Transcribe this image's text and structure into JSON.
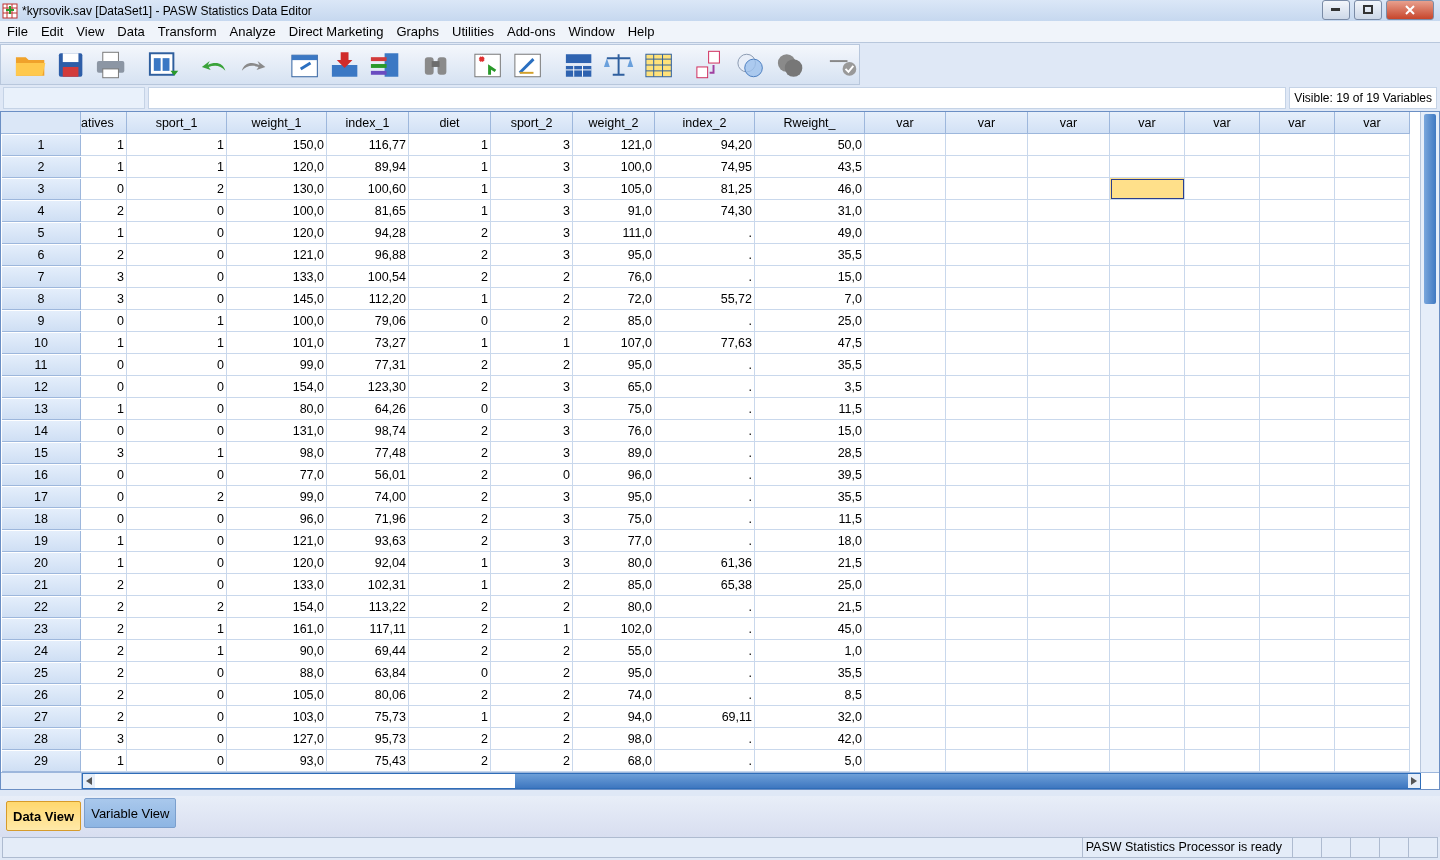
{
  "window": {
    "title": "*kyrsovik.sav [DataSet1] - PASW Statistics Data Editor"
  },
  "menu": [
    "File",
    "Edit",
    "View",
    "Data",
    "Transform",
    "Analyze",
    "Direct Marketing",
    "Graphs",
    "Utilities",
    "Add-ons",
    "Window",
    "Help"
  ],
  "visible_info": "Visible: 19 of 19 Variables",
  "columns": [
    {
      "label": "atives",
      "selected": false
    },
    {
      "label": "sport_1",
      "selected": false
    },
    {
      "label": "weight_1",
      "selected": false
    },
    {
      "label": "index_1",
      "selected": false
    },
    {
      "label": "diet",
      "selected": false
    },
    {
      "label": "sport_2",
      "selected": false
    },
    {
      "label": "weight_2",
      "selected": false
    },
    {
      "label": "index_2",
      "selected": false
    },
    {
      "label": "Rweight_",
      "selected": false
    },
    {
      "label": "var",
      "selected": false
    },
    {
      "label": "var",
      "selected": false
    },
    {
      "label": "var",
      "selected": false
    },
    {
      "label": "var",
      "selected": true
    },
    {
      "label": "var",
      "selected": false
    },
    {
      "label": "var",
      "selected": false
    },
    {
      "label": "var",
      "selected": false
    }
  ],
  "rows": [
    {
      "number": "1",
      "selected": false,
      "values": [
        "1",
        "1",
        "150,0",
        "116,77",
        "1",
        "3",
        "121,0",
        "94,20",
        "50,0"
      ]
    },
    {
      "number": "2",
      "selected": false,
      "values": [
        "1",
        "1",
        "120,0",
        "89,94",
        "1",
        "3",
        "100,0",
        "74,95",
        "43,5"
      ]
    },
    {
      "number": "3",
      "selected": true,
      "values": [
        "0",
        "2",
        "130,0",
        "100,60",
        "1",
        "3",
        "105,0",
        "81,25",
        "46,0"
      ]
    },
    {
      "number": "4",
      "selected": false,
      "values": [
        "2",
        "0",
        "100,0",
        "81,65",
        "1",
        "3",
        "91,0",
        "74,30",
        "31,0"
      ]
    },
    {
      "number": "5",
      "selected": false,
      "values": [
        "1",
        "0",
        "120,0",
        "94,28",
        "2",
        "3",
        "111,0",
        ".",
        "49,0"
      ]
    },
    {
      "number": "6",
      "selected": false,
      "values": [
        "2",
        "0",
        "121,0",
        "96,88",
        "2",
        "3",
        "95,0",
        ".",
        "35,5"
      ]
    },
    {
      "number": "7",
      "selected": false,
      "values": [
        "3",
        "0",
        "133,0",
        "100,54",
        "2",
        "2",
        "76,0",
        ".",
        "15,0"
      ]
    },
    {
      "number": "8",
      "selected": false,
      "values": [
        "3",
        "0",
        "145,0",
        "112,20",
        "1",
        "2",
        "72,0",
        "55,72",
        "7,0"
      ]
    },
    {
      "number": "9",
      "selected": false,
      "values": [
        "0",
        "1",
        "100,0",
        "79,06",
        "0",
        "2",
        "85,0",
        ".",
        "25,0"
      ]
    },
    {
      "number": "10",
      "selected": false,
      "values": [
        "1",
        "1",
        "101,0",
        "73,27",
        "1",
        "1",
        "107,0",
        "77,63",
        "47,5"
      ]
    },
    {
      "number": "11",
      "selected": false,
      "values": [
        "0",
        "0",
        "99,0",
        "77,31",
        "2",
        "2",
        "95,0",
        ".",
        "35,5"
      ]
    },
    {
      "number": "12",
      "selected": false,
      "values": [
        "0",
        "0",
        "154,0",
        "123,30",
        "2",
        "3",
        "65,0",
        ".",
        "3,5"
      ]
    },
    {
      "number": "13",
      "selected": false,
      "values": [
        "1",
        "0",
        "80,0",
        "64,26",
        "0",
        "3",
        "75,0",
        ".",
        "11,5"
      ]
    },
    {
      "number": "14",
      "selected": false,
      "values": [
        "0",
        "0",
        "131,0",
        "98,74",
        "2",
        "3",
        "76,0",
        ".",
        "15,0"
      ]
    },
    {
      "number": "15",
      "selected": false,
      "values": [
        "3",
        "1",
        "98,0",
        "77,48",
        "2",
        "3",
        "89,0",
        ".",
        "28,5"
      ]
    },
    {
      "number": "16",
      "selected": false,
      "values": [
        "0",
        "0",
        "77,0",
        "56,01",
        "2",
        "0",
        "96,0",
        ".",
        "39,5"
      ]
    },
    {
      "number": "17",
      "selected": false,
      "values": [
        "0",
        "2",
        "99,0",
        "74,00",
        "2",
        "3",
        "95,0",
        ".",
        "35,5"
      ]
    },
    {
      "number": "18",
      "selected": false,
      "values": [
        "0",
        "0",
        "96,0",
        "71,96",
        "2",
        "3",
        "75,0",
        ".",
        "11,5"
      ]
    },
    {
      "number": "19",
      "selected": false,
      "values": [
        "1",
        "0",
        "121,0",
        "93,63",
        "2",
        "3",
        "77,0",
        ".",
        "18,0"
      ]
    },
    {
      "number": "20",
      "selected": false,
      "values": [
        "1",
        "0",
        "120,0",
        "92,04",
        "1",
        "3",
        "80,0",
        "61,36",
        "21,5"
      ]
    },
    {
      "number": "21",
      "selected": false,
      "values": [
        "2",
        "0",
        "133,0",
        "102,31",
        "1",
        "2",
        "85,0",
        "65,38",
        "25,0"
      ]
    },
    {
      "number": "22",
      "selected": false,
      "values": [
        "2",
        "2",
        "154,0",
        "113,22",
        "2",
        "2",
        "80,0",
        ".",
        "21,5"
      ]
    },
    {
      "number": "23",
      "selected": false,
      "values": [
        "2",
        "1",
        "161,0",
        "117,11",
        "2",
        "1",
        "102,0",
        ".",
        "45,0"
      ]
    },
    {
      "number": "24",
      "selected": false,
      "values": [
        "2",
        "1",
        "90,0",
        "69,44",
        "2",
        "2",
        "55,0",
        ".",
        "1,0"
      ]
    },
    {
      "number": "25",
      "selected": false,
      "values": [
        "2",
        "0",
        "88,0",
        "63,84",
        "0",
        "2",
        "95,0",
        ".",
        "35,5"
      ]
    },
    {
      "number": "26",
      "selected": false,
      "values": [
        "2",
        "0",
        "105,0",
        "80,06",
        "2",
        "2",
        "74,0",
        ".",
        "8,5"
      ]
    },
    {
      "number": "27",
      "selected": false,
      "values": [
        "2",
        "0",
        "103,0",
        "75,73",
        "1",
        "2",
        "94,0",
        "69,11",
        "32,0"
      ]
    },
    {
      "number": "28",
      "selected": false,
      "values": [
        "3",
        "0",
        "127,0",
        "95,73",
        "2",
        "2",
        "98,0",
        ".",
        "42,0"
      ]
    },
    {
      "number": "29",
      "selected": false,
      "values": [
        "1",
        "0",
        "93,0",
        "75,43",
        "2",
        "2",
        "68,0",
        ".",
        "5,0"
      ]
    }
  ],
  "view_tabs": [
    {
      "label": "Data View",
      "selected": true
    },
    {
      "label": "Variable View",
      "selected": false
    }
  ],
  "status_bar": "PASW Statistics Processor is ready"
}
